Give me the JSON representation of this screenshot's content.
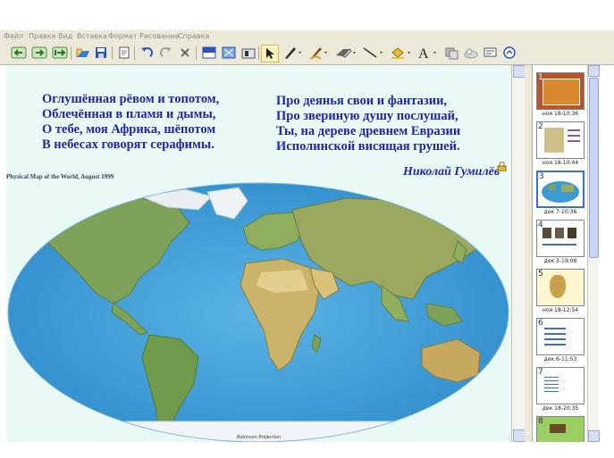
{
  "menu": [
    "Файл",
    "Правка",
    "Вид",
    "Вставка",
    "Формат",
    "Рисование",
    "Справка"
  ],
  "toolbar_icons": [
    "back-icon",
    "forward-icon",
    "add-page-icon",
    "open-icon",
    "save-icon",
    "paste-icon",
    "undo-icon",
    "redo-icon",
    "delete-icon",
    "screen-shade-icon",
    "full-screen-icon",
    "capture-icon",
    "select-icon",
    "pen-icon",
    "creative-pen-icon",
    "eraser-icon",
    "line-icon",
    "fill-icon",
    "text-icon",
    "properties-icon",
    "move-toolbar-icon"
  ],
  "poem": {
    "left": [
      "Оглушённая рёвом и топотом,",
      "Облечённая в пламя и дымы,",
      "О тебе, моя Африка, шёпотом",
      "В небесах говорят серафимы."
    ],
    "right": [
      "Про деянья свои и фантазии,",
      "Про звериную душу послушай,",
      "Ты, на дереве древнем Евразии",
      "Исполинской висящая грушей."
    ]
  },
  "author": "Николай Гумилёв",
  "map": {
    "title": "Physical Map of the World, August 1999",
    "caption": "Robinson Projection",
    "ocean_color": "#3a9ad3",
    "land_color": "#7fa35a"
  },
  "slides": [
    {
      "number": "1",
      "date": "ноя 18-10:36",
      "selected": false
    },
    {
      "number": "2",
      "date": "ноя 18-10:44",
      "selected": false
    },
    {
      "number": "3",
      "date": "дек 7-10:36",
      "selected": true
    },
    {
      "number": "4",
      "date": "дек 3-19:08",
      "selected": false
    },
    {
      "number": "5",
      "date": "ноя 18-12:54",
      "selected": false
    },
    {
      "number": "6",
      "date": "дек 6-11:53",
      "selected": false
    },
    {
      "number": "7",
      "date": "дек 18-20:35",
      "selected": false
    },
    {
      "number": "8",
      "date": "",
      "selected": false
    }
  ]
}
